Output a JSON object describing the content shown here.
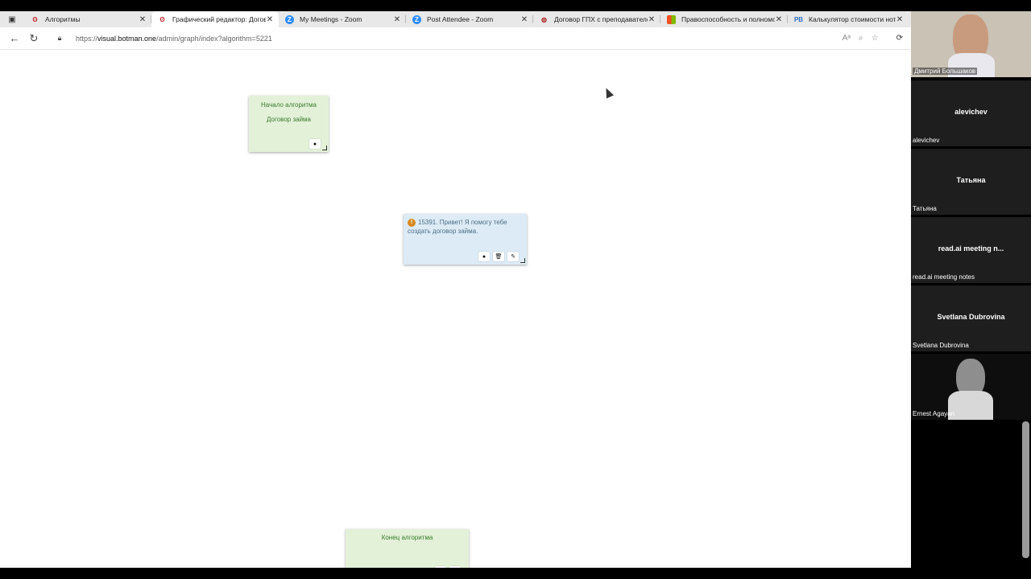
{
  "tabs": [
    {
      "title": "Алгоритмы",
      "favicon": "botman-icon",
      "active": false
    },
    {
      "title": "Графический редактор: Догово",
      "favicon": "botman-icon",
      "active": true
    },
    {
      "title": "My Meetings - Zoom",
      "favicon": "zoom-icon",
      "active": false
    },
    {
      "title": "Post Attendee - Zoom",
      "favicon": "zoom-icon",
      "active": false
    },
    {
      "title": "Договор ГПХ с преподавателе",
      "favicon": "doc-icon",
      "active": false
    },
    {
      "title": "Правоспособность и полномо",
      "favicon": "grid-icon",
      "active": false
    },
    {
      "title": "Калькулятор стоимости нотар",
      "favicon": "pb-icon",
      "active": false
    }
  ],
  "address": {
    "prefix": "https://",
    "domain": "visual.botman.one",
    "path": "/admin/graph/index?algorithm=5221"
  },
  "nodes": {
    "start": {
      "line1": "Начало алгоритма",
      "line2": "Договор займа"
    },
    "message": {
      "text": "15391. Привет! Я помогу тебе создать договор займа."
    },
    "end": {
      "line1": "Конец алгоритма"
    }
  },
  "participants": [
    {
      "name": "Дмитрий Большаков",
      "center": "",
      "video": true
    },
    {
      "name": "alevichev",
      "center": "alevichev",
      "video": false
    },
    {
      "name": "Татьяна",
      "center": "Татьяна",
      "video": false
    },
    {
      "name": "read.ai meeting notes",
      "center": "read.ai meeting n...",
      "video": false
    },
    {
      "name": "Svetlana Dubrovina",
      "center": "Svetlana Dubrovina",
      "video": false
    },
    {
      "name": "Ernest Agayan",
      "center": "",
      "video": true
    }
  ],
  "colors": {
    "node_green": "#e3f1d9",
    "node_blue": "#dcebf5",
    "warning": "#d98a1e"
  }
}
